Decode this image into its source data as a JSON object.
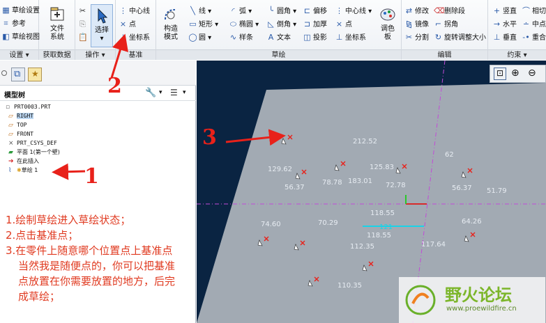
{
  "ribbon": {
    "setup": {
      "group_label": "设置",
      "sketch_setup": "草绘设置",
      "reference": "参考",
      "sketch_view": "草绘视图"
    },
    "get_data": {
      "group_label": "获取数据",
      "file_system": "文件\n系统"
    },
    "operations": {
      "group_label": "操作",
      "select": "选择"
    },
    "datum": {
      "group_label": "基准",
      "centerline": "中心线",
      "point": "点",
      "coord_system": "坐标系"
    },
    "sketch": {
      "group_label": "草绘",
      "construction_mode": "构造\n模式",
      "line": "线",
      "arc": "弧",
      "fillet": "圆角",
      "offset": "偏移",
      "centerline": "中心线",
      "rectangle": "矩形",
      "ellipse": "椭圆",
      "chamfer": "倒角",
      "thicken": "加厚",
      "point": "点",
      "circle": "圆",
      "spline": "样条",
      "text": "文本",
      "project": "投影",
      "coord_system": "坐标系",
      "palette": "调色\n板"
    },
    "edit": {
      "group_label": "编辑",
      "modify": "修改",
      "delete_segment": "删除段",
      "mirror": "镜像",
      "corner": "拐角",
      "divide": "分割",
      "rotate_resize": "旋转调整大小"
    },
    "constrain": {
      "group_label": "约束",
      "vertical": "竖直",
      "horizontal": "水平",
      "perpendicular": "垂直",
      "tangent": "相切",
      "midpoint": "中点",
      "coincident": "重合"
    }
  },
  "model_tree": {
    "title": "模型树",
    "items": [
      "PRT0003.PRT",
      "RIGHT",
      "TOP",
      "FRONT",
      "PRT_CSYS_DEF",
      "平面 1(第一个壁)",
      "在此插入",
      "草绘 1"
    ]
  },
  "instructions": [
    "1.绘制草绘进入草绘状态；",
    "2.点击基准点；",
    "3.在零件上随意哪个位置点上基准点",
    "当然我是随便点的，你可以把基准",
    "点放置在你需要放置的地方，后完",
    "成草绘；"
  ],
  "annotations": {
    "one": "1",
    "two": "2",
    "three": "3"
  },
  "dimensions": [
    "212.52",
    "129.62",
    "56.37",
    "78.78",
    "125.83",
    "183.01",
    "72.78",
    "56.37",
    "51.79",
    "118.55",
    "74.60",
    "70.29",
    "118.55",
    "117.64",
    "64.26",
    "112.35",
    "110.35",
    "62",
    "121"
  ],
  "watermark": {
    "name": "野火论坛",
    "url": "www.proewildfire.cn"
  },
  "colors": {
    "accent": "#e8211a",
    "canvas_bg": "#0a2442",
    "part_face": "#a2aab3",
    "datum_axis": "#c24ad8",
    "selection": "#19d3e8"
  }
}
